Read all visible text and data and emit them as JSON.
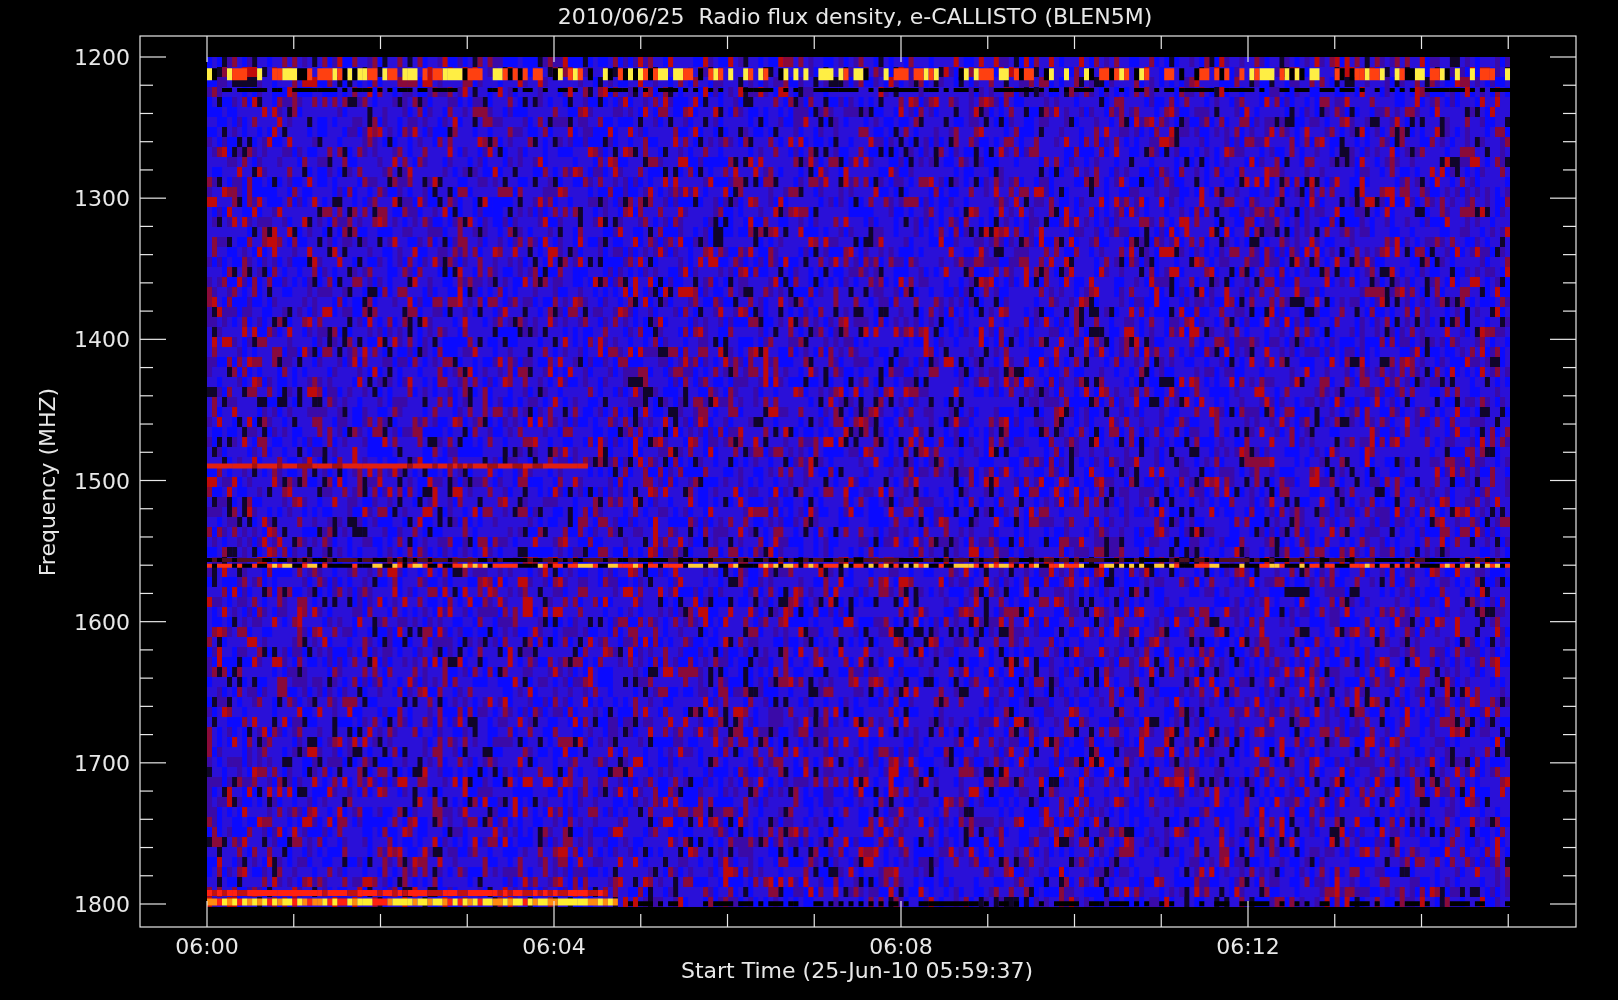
{
  "title": "2010/06/25  Radio flux density, e-CALLISTO (BLEN5M)",
  "y_axis": {
    "label": "Frequency (MHZ)",
    "ticks": [
      "1200",
      "1300",
      "1400",
      "1500",
      "1600",
      "1700",
      "1800"
    ]
  },
  "x_axis": {
    "label": "Start Time (25-Jun-10 05:59:37)",
    "ticks": [
      "06:00",
      "06:04",
      "06:08",
      "06:12"
    ]
  }
}
